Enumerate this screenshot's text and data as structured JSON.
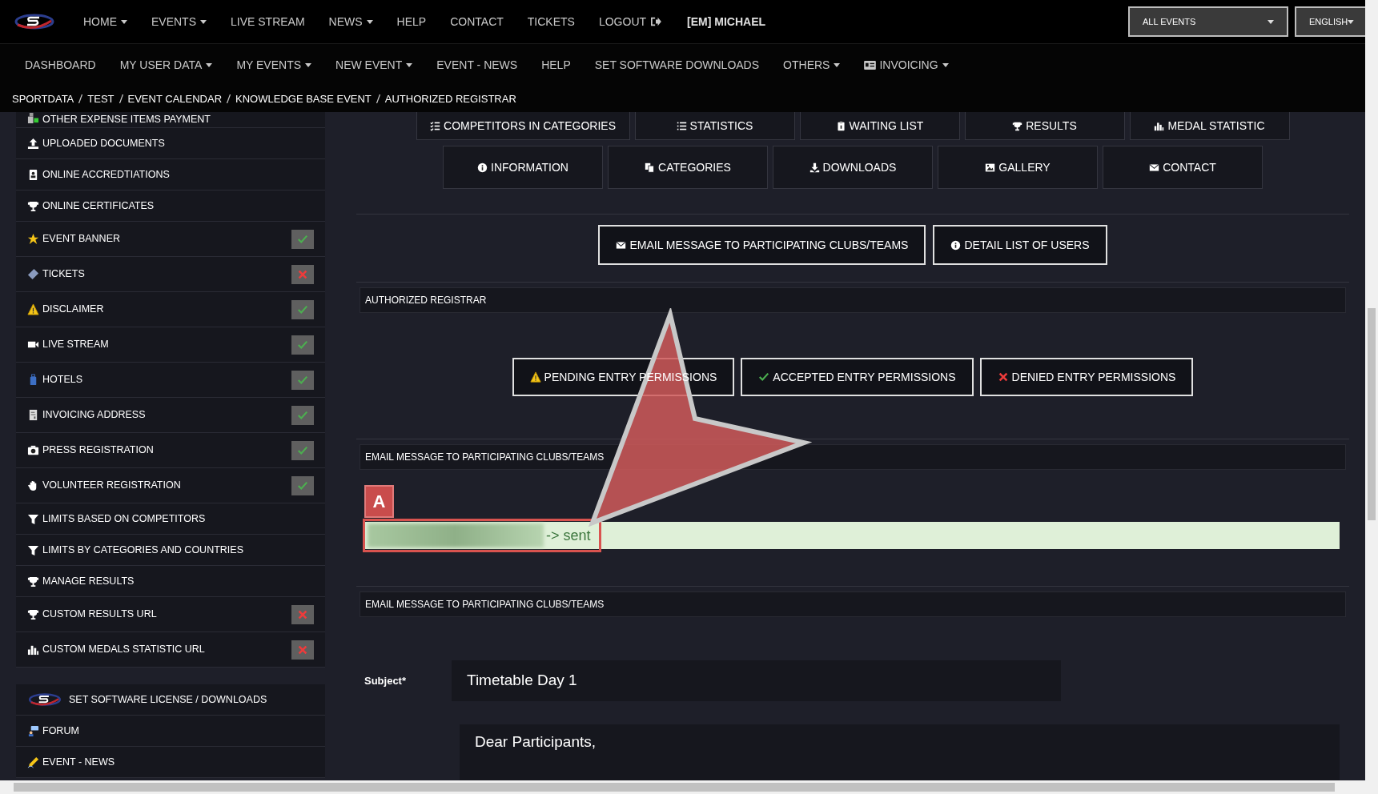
{
  "top_nav": [
    {
      "label": "HOME",
      "kind": "menu",
      "dropdown": true
    },
    {
      "label": "EVENTS",
      "kind": "menu",
      "dropdown": true
    },
    {
      "label": "LIVE STREAM",
      "kind": "menu",
      "dropdown": false
    },
    {
      "label": "NEWS",
      "kind": "menu",
      "dropdown": true
    },
    {
      "label": "HELP",
      "kind": "menu",
      "dropdown": false
    },
    {
      "label": "CONTACT",
      "kind": "menu",
      "dropdown": false
    },
    {
      "label": "TICKETS",
      "kind": "menu",
      "dropdown": false
    },
    {
      "label": "LOGOUT",
      "kind": "logout",
      "dropdown": false
    },
    {
      "label": "[EM] MICHAEL",
      "kind": "user",
      "dropdown": false
    }
  ],
  "selects": [
    {
      "value": "ALL EVENTS"
    },
    {
      "value": "ENGLISH"
    }
  ],
  "sub_nav": [
    {
      "label": "DASHBOARD",
      "dropdown": false
    },
    {
      "label": "MY USER DATA",
      "dropdown": true
    },
    {
      "label": "MY EVENTS",
      "dropdown": true
    },
    {
      "label": "NEW EVENT",
      "dropdown": true
    },
    {
      "label": "EVENT - NEWS",
      "dropdown": false
    },
    {
      "label": "HELP",
      "dropdown": false
    },
    {
      "label": "SET SOFTWARE DOWNLOADS",
      "dropdown": false
    },
    {
      "label": "OTHERS",
      "dropdown": true
    },
    {
      "label": "INVOICING",
      "dropdown": true
    }
  ],
  "breadcrumb": [
    "SPORTDATA",
    "TEST",
    "EVENT CALENDAR",
    "KNOWLEDGE BASE EVENT",
    "AUTHORIZED REGISTRAR"
  ],
  "sidebar": {
    "sections": [
      {
        "items": [
          {
            "label": "OTHER EXPENSE ITEMS PAYMENT"
          },
          {
            "label": "UPLOADED DOCUMENTS"
          },
          {
            "label": "ONLINE ACCREDTIATIONS"
          },
          {
            "label": "ONLINE CERTIFICATES"
          },
          {
            "label": "EVENT BANNER",
            "enabled": true
          },
          {
            "label": "TICKETS",
            "enabled": false
          },
          {
            "label": "DISCLAIMER",
            "enabled": true
          },
          {
            "label": "LIVE STREAM",
            "enabled": true
          },
          {
            "label": "HOTELS",
            "enabled": true
          },
          {
            "label": "INVOICING ADDRESS",
            "enabled": true
          },
          {
            "label": "PRESS REGISTRATION",
            "enabled": true
          },
          {
            "label": "VOLUNTEER REGISTRATION",
            "enabled": true
          },
          {
            "label": "LIMITS BASED ON COMPETITORS"
          },
          {
            "label": "LIMITS BY CATEGORIES AND COUNTRIES"
          },
          {
            "label": "MANAGE RESULTS"
          },
          {
            "label": "CUSTOM RESULTS URL",
            "enabled": false
          },
          {
            "label": "CUSTOM MEDALS STATISTIC URL",
            "enabled": false
          }
        ]
      },
      {
        "items": [
          {
            "label": "SET SOFTWARE LICENSE / DOWNLOADS"
          },
          {
            "label": "FORUM"
          },
          {
            "label": "EVENT - NEWS"
          }
        ]
      }
    ]
  },
  "event_tabs": [
    [
      "COMPETITORS IN CATEGORIES",
      "STATISTICS",
      "WAITING LIST",
      "RESULTS",
      "MEDAL STATISTIC"
    ],
    [
      "INFORMATION",
      "CATEGORIES",
      "DOWNLOADS",
      "GALLERY",
      "CONTACT"
    ]
  ],
  "action_buttons": [
    "EMAIL MESSAGE TO PARTICIPATING CLUBS/TEAMS",
    "DETAIL LIST OF USERS"
  ],
  "panels": [
    {
      "title": "AUTHORIZED REGISTRAR",
      "kind": "permissions",
      "buttons": [
        {
          "label": "PENDING ENTRY PERMISSIONS",
          "kind": "pending"
        },
        {
          "label": "ACCEPTED ENTRY PERMISSIONS",
          "kind": "accepted"
        },
        {
          "label": "DENIED ENTRY PERMISSIONS",
          "kind": "denied"
        }
      ]
    },
    {
      "title": "EMAIL MESSAGE TO PARTICIPATING CLUBS/TEAMS",
      "kind": "result",
      "annotation": "A",
      "message": "-> sent"
    },
    {
      "title": "EMAIL MESSAGE TO PARTICIPATING CLUBS/TEAMS",
      "kind": "form",
      "subject_label": "Subject*",
      "subject": "Timetable Day 1",
      "body": "Dear Participants,"
    }
  ]
}
